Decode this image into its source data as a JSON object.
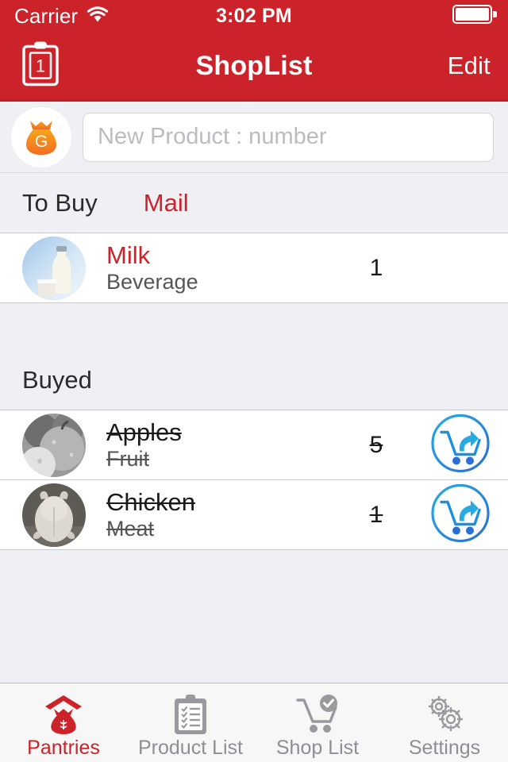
{
  "status_bar": {
    "carrier": "Carrier",
    "wifi_icon": "wifi-icon",
    "time": "3:02 PM",
    "battery_icon": "battery-icon"
  },
  "nav_bar": {
    "left_icon": "clipboard-icon",
    "left_icon_badge": "1",
    "title": "ShopList",
    "edit_label": "Edit"
  },
  "input_row": {
    "avatar_icon": "money-bag-icon",
    "avatar_letter": "G",
    "placeholder": "New Product : number",
    "value": ""
  },
  "sections": [
    {
      "title": "To Buy",
      "action_label": "Mail",
      "items": [
        {
          "name": "Milk",
          "category": "Beverage",
          "quantity": "1",
          "thumb": "milk-bottle-photo",
          "bought": false,
          "action_icon": ""
        }
      ]
    },
    {
      "title": "Buyed",
      "action_label": "",
      "items": [
        {
          "name": "Apples",
          "category": "Fruit",
          "quantity": "5",
          "thumb": "apples-photo",
          "bought": true,
          "action_icon": "cart-restore-icon"
        },
        {
          "name": "Chicken",
          "category": "Meat",
          "quantity": "1",
          "thumb": "chicken-photo",
          "bought": true,
          "action_icon": "cart-restore-icon"
        }
      ]
    }
  ],
  "tab_bar": {
    "items": [
      {
        "label": "Pantries",
        "icon": "pantry-bag-icon",
        "active": true
      },
      {
        "label": "Product List",
        "icon": "clipboard-checklist-icon",
        "active": false
      },
      {
        "label": "Shop List",
        "icon": "cart-check-icon",
        "active": false
      },
      {
        "label": "Settings",
        "icon": "gears-icon",
        "active": false
      }
    ]
  },
  "colors": {
    "brand_red": "#CC2229",
    "accent_blue": "#1E90E8",
    "bag_orange": "#F47B20",
    "background": "#EFEFF4",
    "inactive_gray": "#8E8E93"
  }
}
